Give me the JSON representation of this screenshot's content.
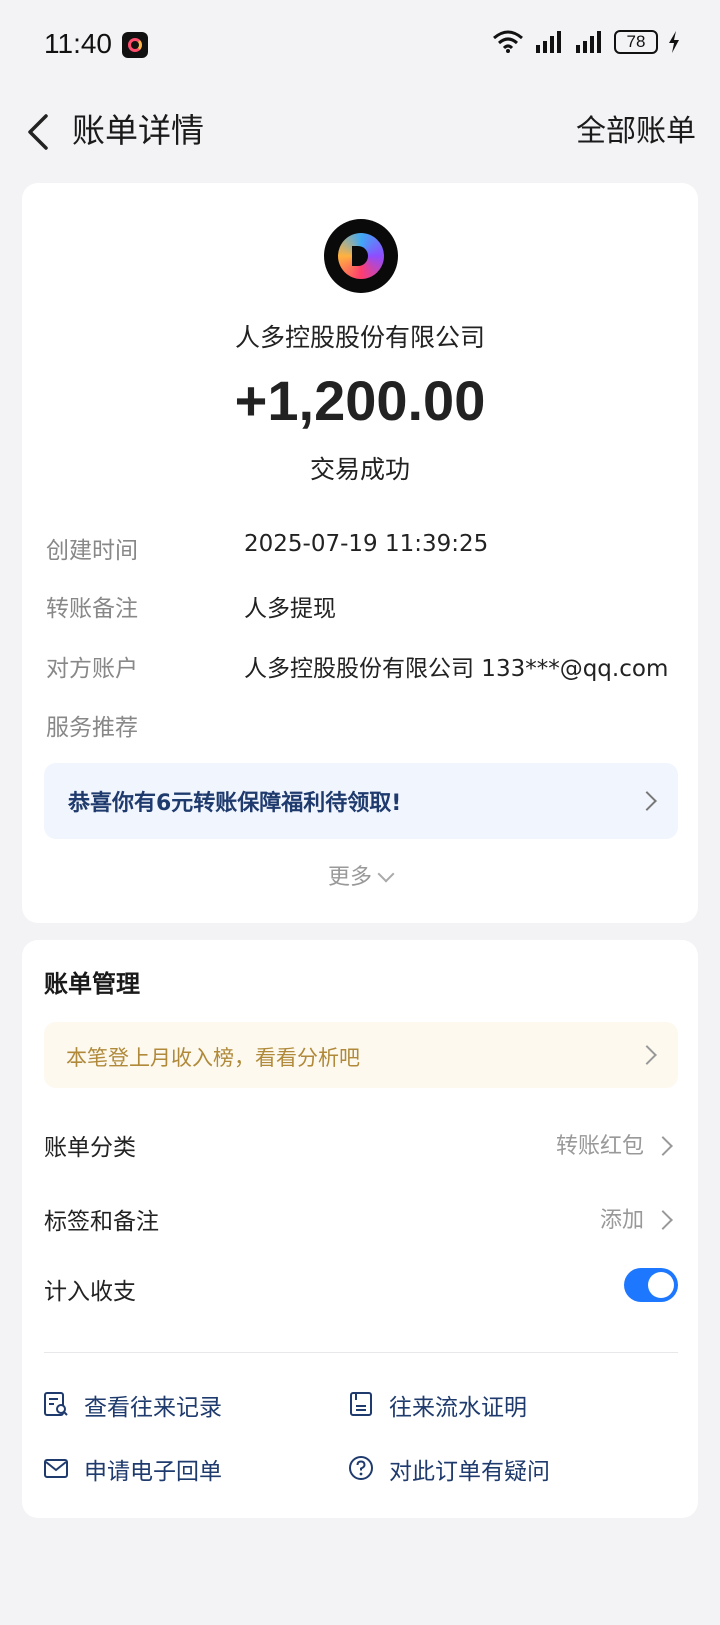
{
  "status_bar": {
    "time": "11:40",
    "battery": "78"
  },
  "header": {
    "title": "账单详情",
    "all_bills": "全部账单"
  },
  "transaction": {
    "merchant": "人多控股股份有限公司",
    "amount": "+1,200.00",
    "status": "交易成功"
  },
  "details": [
    {
      "label": "创建时间",
      "value": "2025-07-19 11:39:25"
    },
    {
      "label": "转账备注",
      "value": "人多提现"
    },
    {
      "label": "对方账户",
      "value": "人多控股股份有限公司 133***@qq.com"
    },
    {
      "label": "服务推荐",
      "value": ""
    }
  ],
  "promo": {
    "text": "恭喜你有6元转账保障福利待领取!"
  },
  "more": {
    "label": "更多"
  },
  "bill_management": {
    "title": "账单管理",
    "tip": "本笔登上月收入榜，看看分析吧",
    "category": {
      "label": "账单分类",
      "value": "转账红包"
    },
    "tags": {
      "label": "标签和备注",
      "value": "添加"
    },
    "include": {
      "label": "计入收支",
      "enabled": true
    }
  },
  "actions": [
    {
      "label": "查看往来记录",
      "icon": "record-search-icon"
    },
    {
      "label": "往来流水证明",
      "icon": "statement-icon"
    },
    {
      "label": "申请电子回单",
      "icon": "mail-icon"
    },
    {
      "label": "对此订单有疑问",
      "icon": "question-icon"
    }
  ],
  "colors": {
    "accent": "#1e78ff",
    "link": "#1f3b6e",
    "tip": "#b08a3a"
  }
}
